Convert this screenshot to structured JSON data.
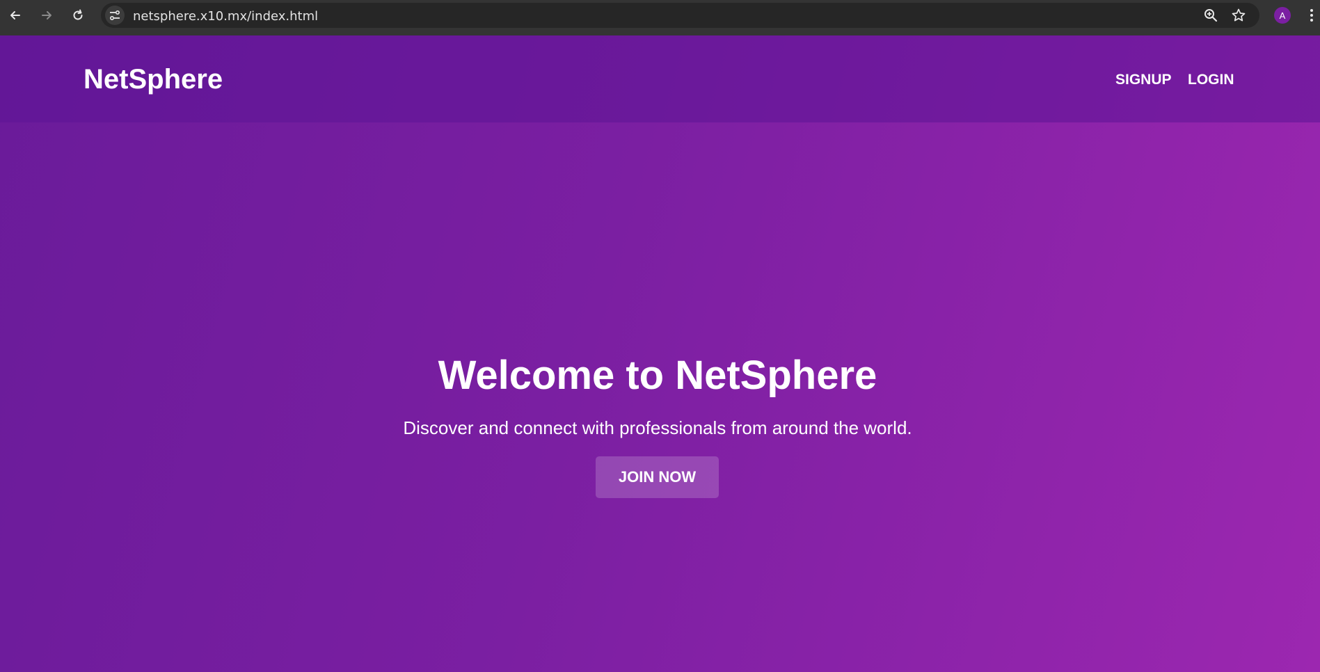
{
  "browser": {
    "url": "netsphere.x10.mx/index.html",
    "profile_initial": "A",
    "back_icon": "arrow-left-icon",
    "forward_icon": "arrow-right-icon",
    "reload_icon": "reload-icon",
    "site_info_icon": "tune-icon",
    "zoom_icon": "zoom-in-icon",
    "bookmark_icon": "star-icon",
    "menu_icon": "more-vert-icon"
  },
  "header": {
    "logo": "NetSphere",
    "nav": {
      "signup": "SIGNUP",
      "login": "LOGIN"
    }
  },
  "hero": {
    "title": "Welcome to NetSphere",
    "subtitle": "Discover and connect with professionals from around the world.",
    "cta": "JOIN NOW"
  },
  "colors": {
    "gradient_start": "#6a1b9a",
    "gradient_end": "#9c27b0",
    "header_overlay": "#5c1496",
    "text": "#ffffff",
    "browser_chrome": "#343434",
    "avatar": "#7b1fa2"
  }
}
